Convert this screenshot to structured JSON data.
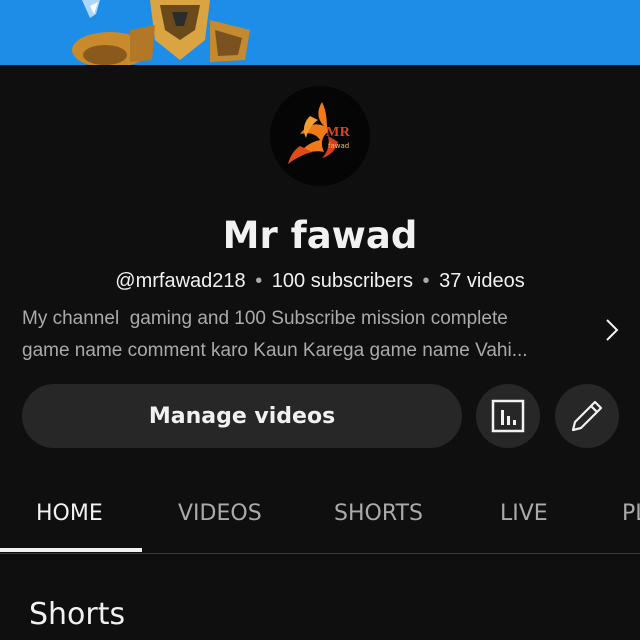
{
  "banner": {
    "background": "#1e8de8",
    "image": "robot-character-art"
  },
  "avatar": {
    "logo_text": "MR",
    "logo_sub": "fawad",
    "logo_colors": {
      "primary": "#e0451a",
      "accent": "#f0a030"
    }
  },
  "channel": {
    "name": "Mr fawad",
    "handle": "@mrfawad218",
    "subscribers": "100 subscribers",
    "videos": "37 videos",
    "separator": "•"
  },
  "description": {
    "line1": "My channel  gaming and 100 Subscribe mission complete",
    "line2": "game name comment karo Kaun Karega game name Vahi..."
  },
  "actions": {
    "manage_label": "Manage videos",
    "analytics_icon": "analytics-icon",
    "edit_icon": "pencil-icon"
  },
  "tabs": [
    {
      "label": "HOME",
      "active": true
    },
    {
      "label": "VIDEOS",
      "active": false
    },
    {
      "label": "SHORTS",
      "active": false
    },
    {
      "label": "LIVE",
      "active": false
    },
    {
      "label": "PLAYLISTS",
      "active": false
    }
  ],
  "sections": {
    "shorts_title": "Shorts"
  },
  "colors": {
    "background": "#0f0f0f",
    "button": "#272727",
    "text": "#f1f1f1",
    "muted": "#aaaaaa"
  }
}
